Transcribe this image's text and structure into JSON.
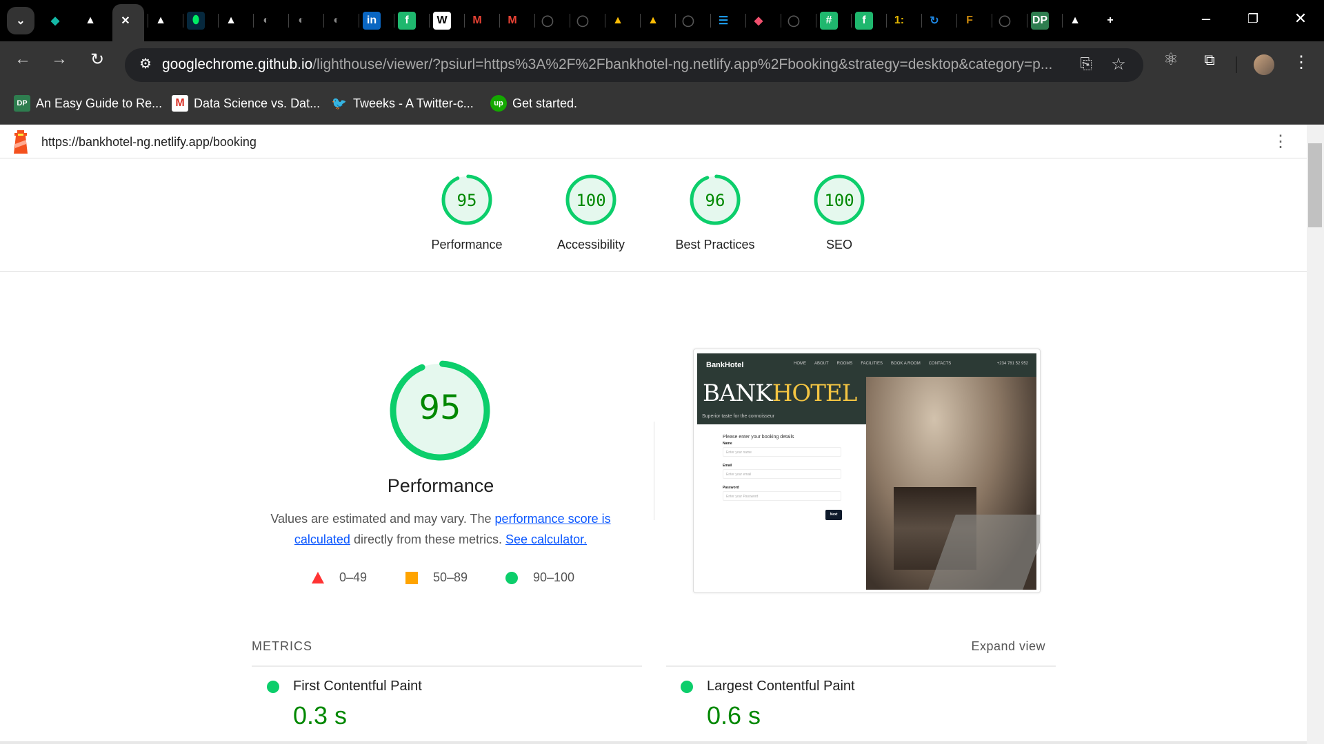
{
  "browser": {
    "tabs": [
      "tab-list-dropdown",
      "diamond-icon",
      "drive-triangle-icon",
      "close-icon",
      "drive-triangle-icon",
      "leaf-icon",
      "drive-triangle-icon",
      "globe-icon",
      "globe-icon",
      "globe-icon",
      "linkedin-icon",
      "f-icon",
      "w-icon",
      "gmail-icon",
      "gmail-icon",
      "github-icon",
      "github-icon",
      "google-drive-icon",
      "google-drive-icon",
      "github-icon",
      "lines-icon",
      "pen-icon",
      "github-icon",
      "hash-icon",
      "f-icon",
      "tag-icon",
      "sync-icon",
      "f-letter-icon",
      "github-icon",
      "dp-icon",
      "drive-triangle-icon",
      "plus-icon"
    ],
    "address_host": "googlechrome.github.io",
    "address_rest": "/lighthouse/viewer/?psiurl=https%3A%2F%2Fbankhotel-ng.netlify.app%2Fbooking&strategy=desktop&category=p...",
    "bookmarks": [
      {
        "icon": "DP",
        "label": "An Easy Guide to Re...",
        "color": "#2e7d4f"
      },
      {
        "icon": "M",
        "label": "Data Science vs. Dat...",
        "color": "#ffffff"
      },
      {
        "icon": "🐦",
        "label": "Tweeks - A Twitter-c...",
        "color": "#1d9bf0"
      },
      {
        "icon": "up",
        "label": "Get started.",
        "color": "#14a800"
      }
    ]
  },
  "lighthouse": {
    "url": "https://bankhotel-ng.netlify.app/booking",
    "colors": {
      "pass": "#0cce6b",
      "pass_text": "#008800",
      "pass_bg": "#e5f8ee",
      "average": "#ffa400",
      "fail": "#ff3333"
    },
    "categories": [
      {
        "label": "Performance",
        "score": 95
      },
      {
        "label": "Accessibility",
        "score": 100
      },
      {
        "label": "Best Practices",
        "score": 96
      },
      {
        "label": "SEO",
        "score": 100
      }
    ],
    "performance": {
      "score": 95,
      "title": "Performance",
      "desc_1": "Values are estimated and may vary. The ",
      "link_1": "performance score is calculated",
      "desc_2": " directly from these metrics. ",
      "link_2": "See calculator."
    },
    "legend": [
      "0–49",
      "50–89",
      "90–100"
    ],
    "metrics_header": "METRICS",
    "expand_view": "Expand view",
    "metrics": [
      {
        "label": "First Contentful Paint",
        "value": "0.3 s"
      },
      {
        "label": "Largest Contentful Paint",
        "value": "0.6 s"
      }
    ]
  },
  "preview": {
    "logo": "BankHotel",
    "nav": [
      "HOME",
      "ABOUT",
      "ROOMS",
      "FACILITIES",
      "BOOK A ROOM",
      "CONTACTS"
    ],
    "phone": "+234 781 52 952",
    "hero_a": "BANK",
    "hero_b": "HOTEL",
    "tagline": "Superior taste for the connoisseur",
    "form_title": "Please enter your booking details",
    "fields": [
      {
        "label": "Name",
        "placeholder": "Enter your name"
      },
      {
        "label": "Email",
        "placeholder": "Enter your email"
      },
      {
        "label": "Password",
        "placeholder": "Enter your Password"
      }
    ],
    "next": "Next"
  }
}
